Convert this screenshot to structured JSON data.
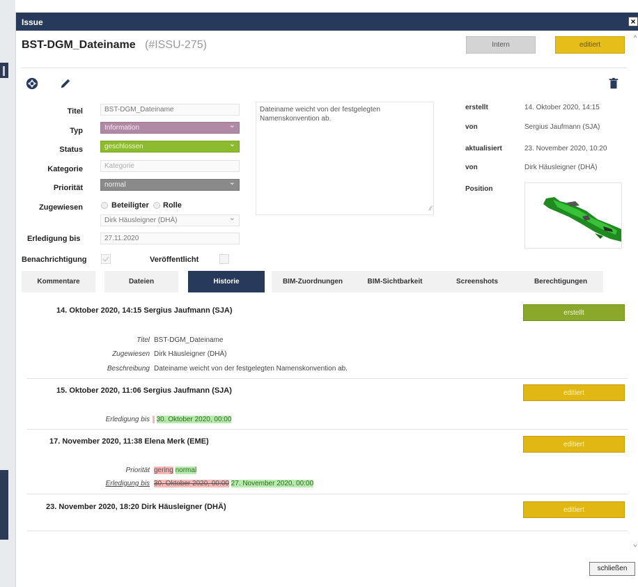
{
  "window": {
    "title": "Issue",
    "close_glyph": "×"
  },
  "header": {
    "issue_name": "BST-DGM_Dateiname",
    "issue_id": "(#ISSU-275)",
    "intern_label": "Intern",
    "status_label": "editiert"
  },
  "toolbar": {
    "camera_icon": "camera-aperture-icon",
    "edit_icon": "pencil-icon",
    "delete_icon": "trash-icon"
  },
  "form": {
    "titel": {
      "label": "Titel",
      "value": "BST-DGM_Dateiname"
    },
    "typ": {
      "label": "Typ",
      "value": "Information"
    },
    "status": {
      "label": "Status",
      "value": "geschlossen"
    },
    "kategorie": {
      "label": "Kategorie",
      "placeholder": "Kategorie"
    },
    "prioritaet": {
      "label": "Priorität",
      "value": "normal"
    },
    "zugewiesen": {
      "label": "Zugewiesen",
      "option_beteiligter": "Beteiligter",
      "option_rolle": "Rolle",
      "value": "Dirk Häusleigner (DHÄ)"
    },
    "erledigung": {
      "label": "Erledigung bis",
      "value": "27.11.2020"
    },
    "benachrichtigung": {
      "label": "Benachrichtigung"
    },
    "veroeffentlicht": {
      "label": "Veröffentlicht"
    },
    "description": "Dateiname weicht von der festgelegten Namenskonvention ab."
  },
  "meta": {
    "erstellt_label": "erstellt",
    "erstellt_value": "14. Oktober 2020, 14:15",
    "von1_label": "von",
    "von1_value": "Sergius Jaufmann (SJA)",
    "aktualisiert_label": "aktualisiert",
    "aktualisiert_value": "23. November 2020, 10:20",
    "von2_label": "von",
    "von2_value": "Dirk Häusleigner (DHÄ)",
    "position_label": "Position"
  },
  "tabs": [
    "Kommentare",
    "Dateien",
    "Historie",
    "BIM-Zuordnungen",
    "BIM-Sichtbarkeit",
    "Screenshots",
    "Berechtigungen"
  ],
  "history": [
    {
      "header": "14. Oktober 2020, 14:15  Sergius Jaufmann (SJA)",
      "badge": "erstellt",
      "changes": [
        {
          "key": "Titel",
          "value": "BST-DGM_Dateiname"
        },
        {
          "key": "Zugewiesen",
          "value": "Dirk Häusleigner (DHÄ)"
        },
        {
          "key": "Beschreibung",
          "value": "Dateiname weicht von der festgelegten Namenskonvention ab."
        }
      ]
    },
    {
      "header": "15. Oktober 2020, 11:06  Sergius Jaufmann (SJA)",
      "badge": "editiert",
      "changes": [
        {
          "key": "Erledigung bis",
          "new": "30. Oktober 2020, 00:00"
        }
      ]
    },
    {
      "header": "17. November 2020, 11:38  Elena Merk (EME)",
      "badge": "editiert",
      "changes": [
        {
          "key": "Priorität",
          "old": "gering",
          "new": "normal"
        },
        {
          "key": "Erledigung bis",
          "old": "30. Oktober 2020, 00:00",
          "new": "27. November 2020, 00:00"
        }
      ]
    },
    {
      "header": "23. November 2020, 18:20  Dirk Häusleigner (DHÄ)",
      "badge": "editiert",
      "changes": []
    }
  ],
  "footer": {
    "close_label": "schließen"
  },
  "colors": {
    "titlebar": "#283a5c",
    "edited": "#e1b713",
    "created": "#8aa82a",
    "deleted_bg": "#f7b7b7",
    "inserted_bg": "#b8eab0"
  }
}
